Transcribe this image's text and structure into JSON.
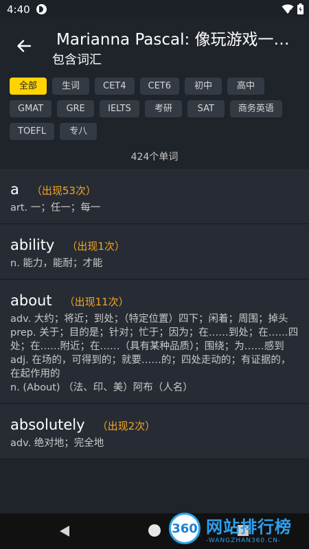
{
  "status": {
    "time": "4:40"
  },
  "header": {
    "title": "Marianna Pascal: 像玩游戏一样学英语",
    "subtitle": "包含词汇"
  },
  "filters": [
    {
      "label": "全部",
      "active": true
    },
    {
      "label": "生词"
    },
    {
      "label": "CET4"
    },
    {
      "label": "CET6"
    },
    {
      "label": "初中"
    },
    {
      "label": "高中"
    },
    {
      "label": "GMAT"
    },
    {
      "label": "GRE"
    },
    {
      "label": "IELTS"
    },
    {
      "label": "考研"
    },
    {
      "label": "SAT"
    },
    {
      "label": "商务英语"
    },
    {
      "label": "TOEFL"
    },
    {
      "label": "专八"
    }
  ],
  "word_count": "424个单词",
  "words": [
    {
      "word": "a",
      "freq": "（出现53次）",
      "def": "art. 一；任一；每一"
    },
    {
      "word": "ability",
      "freq": "（出现1次）",
      "def": "n. 能力，能耐；才能"
    },
    {
      "word": "about",
      "freq": "（出现11次）",
      "def": "adv. 大约；将近；到处；（特定位置）四下；闲着；周围；掉头\nprep. 关于；目的是；针对；忙于；因为；在……到处；在……四处；在……附近；在……（具有某种品质）；围绕；为……感到\nadj. 在场的，可得到的；就要……的；四处走动的；有证据的，在起作用的\nn. (About) （法、印、美）阿布（人名）"
    },
    {
      "word": "absolutely",
      "freq": "（出现2次）",
      "def": "adv. 绝对地；完全地"
    }
  ],
  "watermark": {
    "badge": "360",
    "main": "网站排行榜",
    "sub": "-WANGZHAN360.CN-"
  },
  "colors": {
    "background": "#1f232a",
    "card": "#272c34",
    "chip": "#343a43",
    "accent_chip": "#ffd400",
    "frequency": "#f4a623"
  }
}
